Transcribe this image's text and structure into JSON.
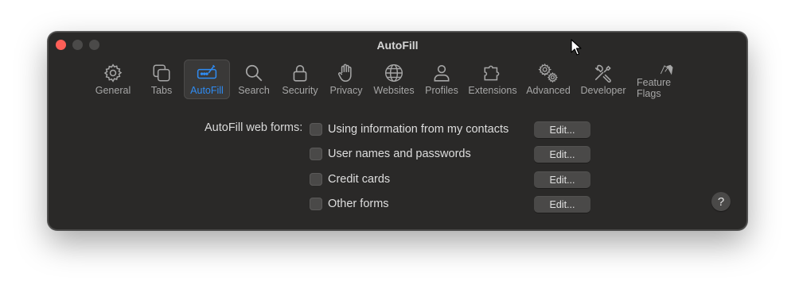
{
  "window": {
    "title": "AutoFill"
  },
  "toolbar": {
    "tabs": [
      {
        "label": "General",
        "icon": "gear-icon"
      },
      {
        "label": "Tabs",
        "icon": "tabs-icon"
      },
      {
        "label": "AutoFill",
        "icon": "autofill-icon",
        "active": true
      },
      {
        "label": "Search",
        "icon": "search-icon"
      },
      {
        "label": "Security",
        "icon": "lock-icon"
      },
      {
        "label": "Privacy",
        "icon": "hand-icon"
      },
      {
        "label": "Websites",
        "icon": "globe-icon"
      },
      {
        "label": "Profiles",
        "icon": "person-icon"
      },
      {
        "label": "Extensions",
        "icon": "puzzle-icon"
      },
      {
        "label": "Advanced",
        "icon": "gears-icon"
      },
      {
        "label": "Developer",
        "icon": "tools-icon"
      },
      {
        "label": "Feature Flags",
        "icon": "flags-icon"
      }
    ]
  },
  "autofill": {
    "section_label": "AutoFill web forms:",
    "options": [
      {
        "label": "Using information from my contacts",
        "checked": false,
        "edit_label": "Edit..."
      },
      {
        "label": "User names and passwords",
        "checked": false,
        "edit_label": "Edit..."
      },
      {
        "label": "Credit cards",
        "checked": false,
        "edit_label": "Edit..."
      },
      {
        "label": "Other forms",
        "checked": false,
        "edit_label": "Edit..."
      }
    ]
  },
  "help": {
    "label": "?"
  },
  "colors": {
    "accent": "#2f8cf3",
    "window_bg": "#2a2928",
    "close": "#fe5f57"
  }
}
